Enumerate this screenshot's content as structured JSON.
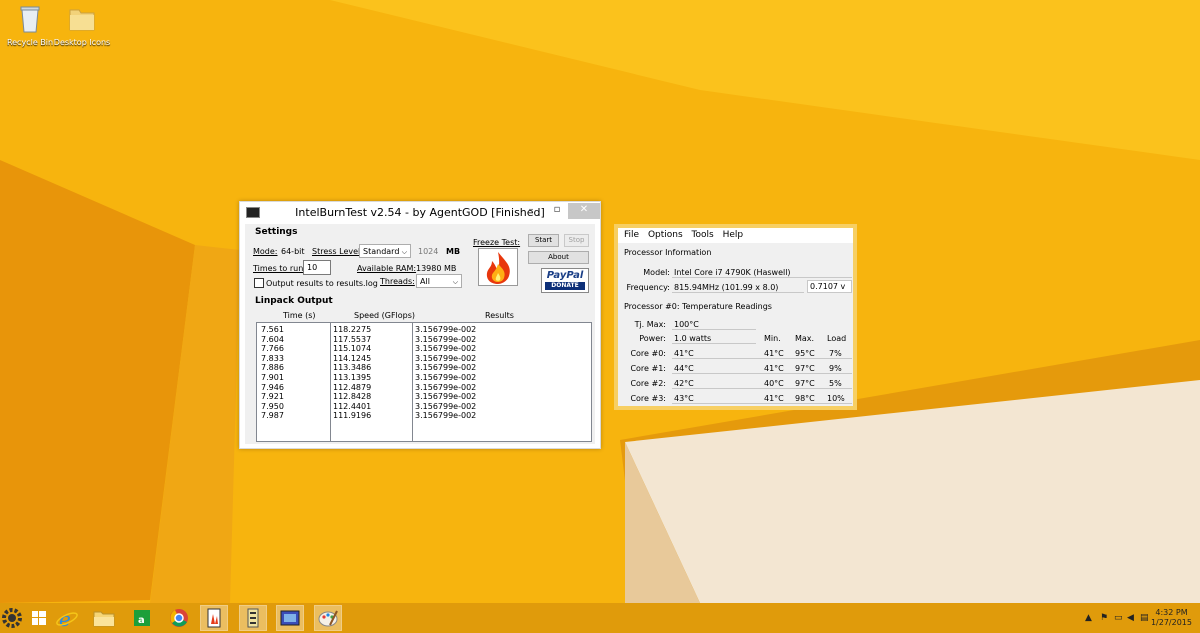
{
  "desktop": {
    "icons": [
      {
        "label": "Recycle Bin",
        "icon": "recycle-bin-icon"
      },
      {
        "label": "Desktop Icons",
        "icon": "folder-icon"
      }
    ]
  },
  "intelburntest": {
    "title": "IntelBurnTest v2.54 - by AgentGOD [Finished]",
    "settings_label": "Settings",
    "mode_label": "Mode:",
    "mode_value": "64-bit",
    "stress_label": "Stress Level:",
    "stress_value": "Standard",
    "mem_value": "1024",
    "mem_unit": "MB",
    "times_label": "Times to run:",
    "times_value": "10",
    "avail_ram_label": "Available RAM:",
    "avail_ram_value": "13980 MB",
    "output_log_label": "Output results to results.log",
    "threads_label": "Threads:",
    "threads_value": "All",
    "freeze_label": "Freeze Test:",
    "start_label": "Start",
    "stop_label": "Stop",
    "about_label": "About",
    "paypal_label": "PayPal",
    "donate_label": "DONATE",
    "linpack_label": "Linpack Output",
    "columns": [
      "Time (s)",
      "Speed (GFlops)",
      "Results"
    ],
    "rows": [
      {
        "time": "7.561",
        "speed": "118.2275",
        "result": "3.156799e-002"
      },
      {
        "time": "7.604",
        "speed": "117.5537",
        "result": "3.156799e-002"
      },
      {
        "time": "7.766",
        "speed": "115.1074",
        "result": "3.156799e-002"
      },
      {
        "time": "7.833",
        "speed": "114.1245",
        "result": "3.156799e-002"
      },
      {
        "time": "7.886",
        "speed": "113.3486",
        "result": "3.156799e-002"
      },
      {
        "time": "7.901",
        "speed": "113.1395",
        "result": "3.156799e-002"
      },
      {
        "time": "7.946",
        "speed": "112.4879",
        "result": "3.156799e-002"
      },
      {
        "time": "7.921",
        "speed": "112.8428",
        "result": "3.156799e-002"
      },
      {
        "time": "7.950",
        "speed": "112.4401",
        "result": "3.156799e-002"
      },
      {
        "time": "7.987",
        "speed": "111.9196",
        "result": "3.156799e-002"
      }
    ]
  },
  "coretemp": {
    "menu": [
      "File",
      "Options",
      "Tools",
      "Help"
    ],
    "proc_info_label": "Processor Information",
    "model_label": "Model:",
    "model_value": "Intel Core i7 4790K (Haswell)",
    "freq_label": "Frequency:",
    "freq_value": "815.94MHz (101.99 x 8.0)",
    "vid_value": "0.7107 v",
    "temp_section": "Processor #0: Temperature Readings",
    "tjmax_label": "Tj. Max:",
    "tjmax_value": "100°C",
    "power_label": "Power:",
    "power_value": "1.0 watts",
    "col_min": "Min.",
    "col_max": "Max.",
    "col_load": "Load",
    "cores": [
      {
        "label": "Core #0:",
        "temp": "41°C",
        "min": "41°C",
        "max": "95°C",
        "load": "7%"
      },
      {
        "label": "Core #1:",
        "temp": "44°C",
        "min": "41°C",
        "max": "97°C",
        "load": "9%"
      },
      {
        "label": "Core #2:",
        "temp": "42°C",
        "min": "40°C",
        "max": "97°C",
        "load": "5%"
      },
      {
        "label": "Core #3:",
        "temp": "43°C",
        "min": "41°C",
        "max": "98°C",
        "load": "10%"
      }
    ]
  },
  "taskbar": {
    "apps": [
      "start-icon",
      "internet-explorer-icon",
      "file-explorer-icon",
      "store-icon",
      "chrome-icon",
      "intelburntest-icon",
      "cpu-tool-icon",
      "cpuz-icon",
      "paint-icon"
    ],
    "time": "4:32 PM",
    "date": "1/27/2015"
  }
}
